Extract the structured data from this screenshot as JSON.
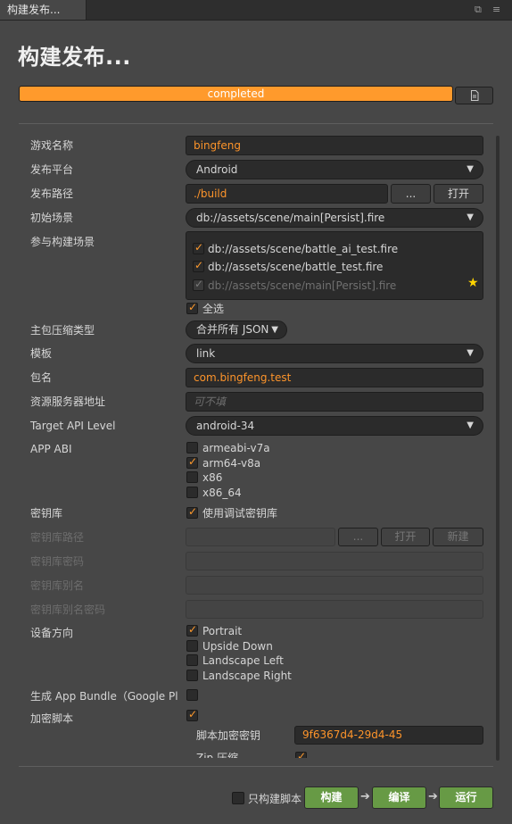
{
  "tab": {
    "title": "构建发布..."
  },
  "header": {
    "title": "构建发布...",
    "progress_text": "completed",
    "progress_value": 1.0
  },
  "fields": {
    "game_name_label": "游戏名称",
    "game_name_value": "bingfeng",
    "platform_label": "发布平台",
    "platform_value": "Android",
    "path_label": "发布路径",
    "path_value": "./build",
    "path_browse": "...",
    "path_open": "打开",
    "start_scene_label": "初始场景",
    "start_scene_value": "db://assets/scene/main[Persist].fire",
    "scenes_label": "参与构建场景",
    "scenes": [
      {
        "name": "db://assets/scene/battle_ai_test.fire",
        "checked": true
      },
      {
        "name": "db://assets/scene/battle_test.fire",
        "checked": true
      },
      {
        "name": "db://assets/scene/main[Persist].fire",
        "checked": true
      }
    ],
    "select_all_label": "全选",
    "compress_label": "主包压缩类型",
    "compress_value": "合并所有 JSON",
    "template_label": "模板",
    "template_value": "link",
    "package_label": "包名",
    "package_value": "com.bingfeng.test",
    "server_label": "资源服务器地址",
    "server_placeholder": "可不填",
    "api_label": "Target API Level",
    "api_value": "android-34",
    "abi_label": "APP ABI",
    "abis": [
      {
        "name": "armeabi-v7a",
        "checked": false
      },
      {
        "name": "arm64-v8a",
        "checked": true
      },
      {
        "name": "x86",
        "checked": false
      },
      {
        "name": "x86_64",
        "checked": false
      }
    ],
    "keystore_label": "密钥库",
    "keystore_debug_label": "使用调试密钥库",
    "keystore_path_label": "密钥库路径",
    "keystore_browse": "...",
    "keystore_open": "打开",
    "keystore_new": "新建",
    "keystore_pwd_label": "密钥库密码",
    "alias_label": "密钥库别名",
    "alias_pwd_label": "密钥库别名密码",
    "orientation_label": "设备方向",
    "orientations": [
      {
        "name": "Portrait",
        "checked": true
      },
      {
        "name": "Upside Down",
        "checked": false
      },
      {
        "name": "Landscape Left",
        "checked": false
      },
      {
        "name": "Landscape Right",
        "checked": false
      }
    ],
    "app_bundle_label": "生成 App Bundle（Google Pl...",
    "encrypt_label": "加密脚本",
    "encrypt_key_label": "脚本加密密钥",
    "encrypt_key_value": "9f6367d4-29d4-45",
    "zip_label": "Zip 压缩"
  },
  "footer": {
    "only_script_label": "只构建脚本",
    "build": "构建",
    "compile": "编译",
    "run": "运行",
    "arrow": "➔"
  },
  "icons": {
    "dropdown": "▼",
    "star": "★",
    "check": "✓"
  },
  "colors": {
    "accent": "#ff9a2c",
    "green": "#679a45",
    "bg": "#474747",
    "field": "#2b2b2b"
  }
}
